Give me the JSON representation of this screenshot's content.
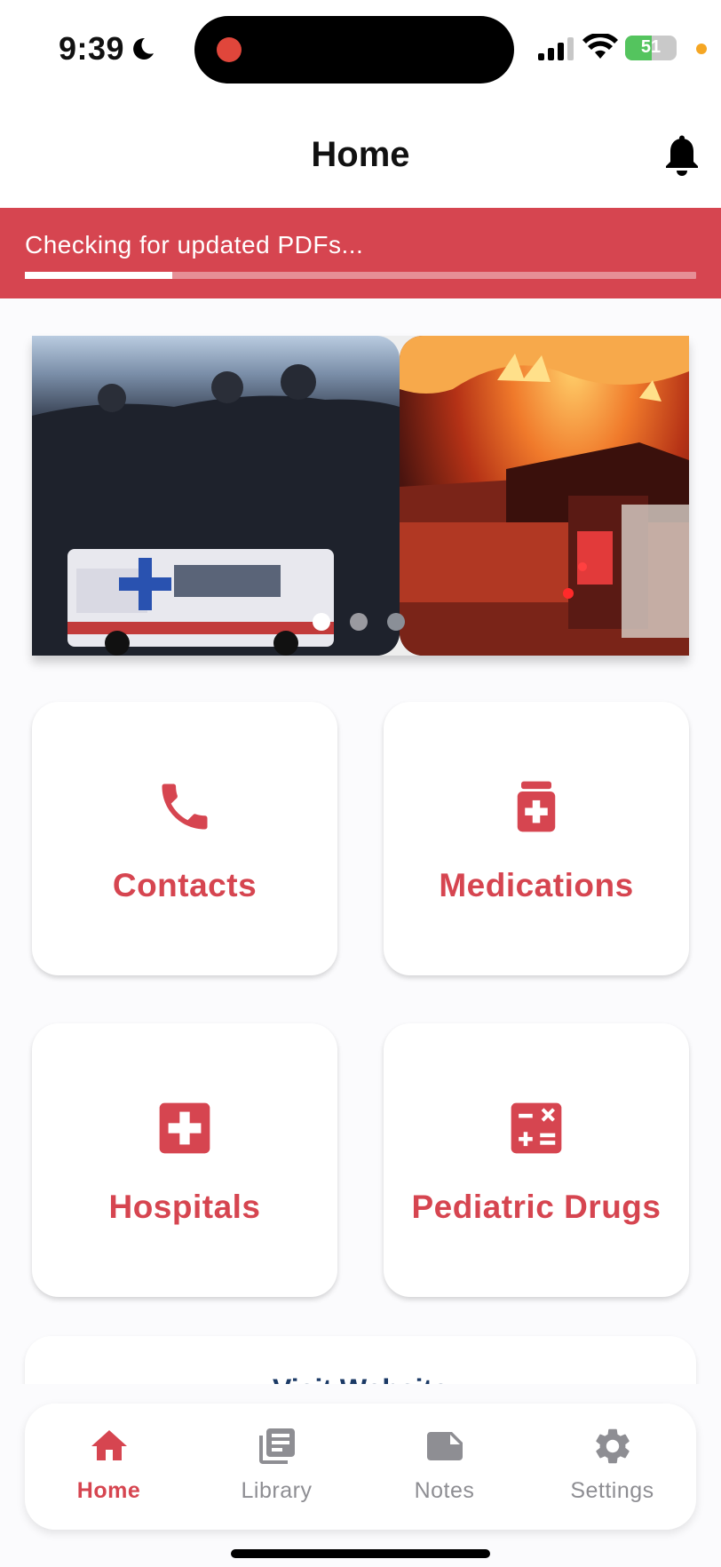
{
  "status_bar": {
    "time": "9:39",
    "battery": "51"
  },
  "header": {
    "title": "Home"
  },
  "banner": {
    "text": "Checking for updated PDFs...",
    "progress": 0.22
  },
  "carousel": {
    "slide_count": 3,
    "active_index": 0
  },
  "tiles": [
    {
      "label": "Contacts",
      "icon": "phone-icon"
    },
    {
      "label": "Medications",
      "icon": "medication-bottle-icon"
    },
    {
      "label": "Hospitals",
      "icon": "hospital-cross-icon"
    },
    {
      "label": "Pediatric Drugs",
      "icon": "calculator-icon"
    }
  ],
  "visit_website": {
    "label": "Visit Website"
  },
  "bottom_nav": [
    {
      "label": "Home",
      "icon": "home-icon",
      "active": true
    },
    {
      "label": "Library",
      "icon": "library-icon",
      "active": false
    },
    {
      "label": "Notes",
      "icon": "note-icon",
      "active": false
    },
    {
      "label": "Settings",
      "icon": "gear-icon",
      "active": false
    }
  ],
  "colors": {
    "accent": "#d64550",
    "inactive": "#8e8e93",
    "link": "#1b3a66"
  }
}
